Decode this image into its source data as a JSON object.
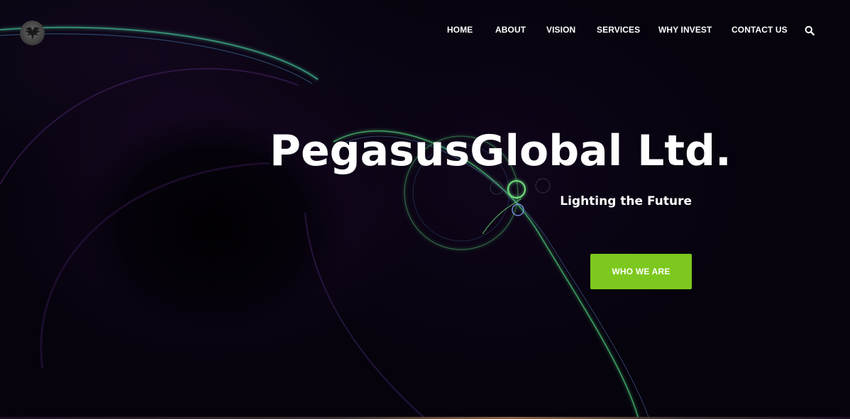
{
  "brand": {
    "logo_icon": "winged-logo-icon"
  },
  "nav": {
    "items": [
      {
        "label": "HOME"
      },
      {
        "label": "ABOUT"
      },
      {
        "label": "VISION"
      },
      {
        "label": "SERVICES"
      },
      {
        "label": "WHY INVEST"
      },
      {
        "label": "CONTACT US"
      }
    ],
    "search_icon": "search-icon"
  },
  "hero": {
    "title": "PegasusGlobal Ltd.",
    "tagline": "Lighting the Future",
    "cta_label": "WHO WE ARE"
  },
  "colors": {
    "background": "#06030d",
    "accent": "#7dc81e",
    "text": "#ffffff",
    "glow_line": "#4fd07a"
  }
}
